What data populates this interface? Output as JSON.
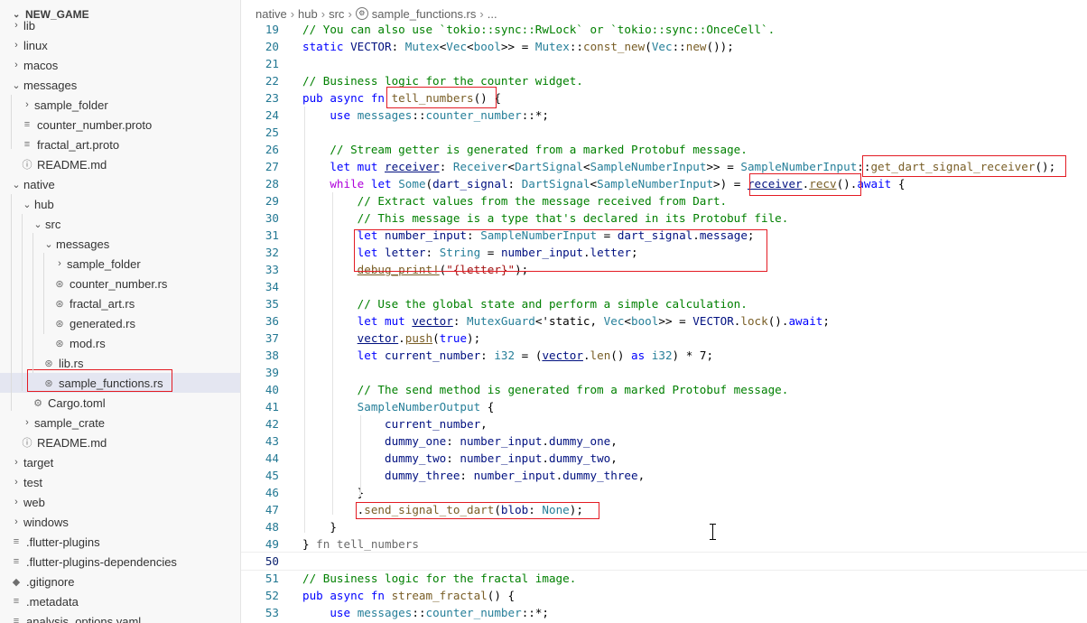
{
  "explorer": {
    "root_label": "NEW_GAME",
    "items": [
      {
        "label": "lib",
        "kind": "folder-closed",
        "depth": 1
      },
      {
        "label": "linux",
        "kind": "folder-closed",
        "depth": 1
      },
      {
        "label": "macos",
        "kind": "folder-closed",
        "depth": 1
      },
      {
        "label": "messages",
        "kind": "folder-open",
        "depth": 1
      },
      {
        "label": "sample_folder",
        "kind": "folder-closed",
        "depth": 2
      },
      {
        "label": "counter_number.proto",
        "kind": "file-lines",
        "depth": 2
      },
      {
        "label": "fractal_art.proto",
        "kind": "file-lines",
        "depth": 2
      },
      {
        "label": "README.md",
        "kind": "file-info",
        "depth": 2
      },
      {
        "label": "native",
        "kind": "folder-open",
        "depth": 1
      },
      {
        "label": "hub",
        "kind": "folder-open",
        "depth": 2
      },
      {
        "label": "src",
        "kind": "folder-open",
        "depth": 3
      },
      {
        "label": "messages",
        "kind": "folder-open",
        "depth": 4
      },
      {
        "label": "sample_folder",
        "kind": "folder-closed",
        "depth": 5
      },
      {
        "label": "counter_number.rs",
        "kind": "file-rust",
        "depth": 5
      },
      {
        "label": "fractal_art.rs",
        "kind": "file-rust",
        "depth": 5
      },
      {
        "label": "generated.rs",
        "kind": "file-rust",
        "depth": 5
      },
      {
        "label": "mod.rs",
        "kind": "file-rust",
        "depth": 5
      },
      {
        "label": "lib.rs",
        "kind": "file-rust",
        "depth": 4
      },
      {
        "label": "sample_functions.rs",
        "kind": "file-rust",
        "depth": 4,
        "selected": true
      },
      {
        "label": "Cargo.toml",
        "kind": "file-gear",
        "depth": 3
      },
      {
        "label": "sample_crate",
        "kind": "folder-closed",
        "depth": 2
      },
      {
        "label": "README.md",
        "kind": "file-info",
        "depth": 2
      },
      {
        "label": "target",
        "kind": "folder-closed",
        "depth": 1
      },
      {
        "label": "test",
        "kind": "folder-closed",
        "depth": 1
      },
      {
        "label": "web",
        "kind": "folder-closed",
        "depth": 1
      },
      {
        "label": "windows",
        "kind": "folder-closed",
        "depth": 1
      },
      {
        "label": ".flutter-plugins",
        "kind": "file-lines",
        "depth": 1
      },
      {
        "label": ".flutter-plugins-dependencies",
        "kind": "file-lines",
        "depth": 1
      },
      {
        "label": ".gitignore",
        "kind": "file-git",
        "depth": 1
      },
      {
        "label": ".metadata",
        "kind": "file-lines",
        "depth": 1
      },
      {
        "label": "analysis_options.yaml",
        "kind": "file-lines",
        "depth": 1
      }
    ]
  },
  "breadcrumb": {
    "parts": [
      "native",
      "hub",
      "src",
      "sample_functions.rs",
      "..."
    ]
  },
  "editor": {
    "current_line": 50,
    "lines": [
      {
        "n": "19",
        "tokens": [
          [
            "c",
            "// You can also use `tokio::sync::RwLock` or `tokio::sync::OnceCell`."
          ]
        ]
      },
      {
        "n": "20",
        "tokens": [
          [
            "k",
            "static"
          ],
          [
            "",
            " "
          ],
          [
            "v",
            "VECTOR"
          ],
          [
            "",
            ": "
          ],
          [
            "t",
            "Mutex"
          ],
          [
            "",
            "<"
          ],
          [
            "t",
            "Vec"
          ],
          [
            "",
            "<"
          ],
          [
            "t",
            "bool"
          ],
          [
            "",
            ">> = "
          ],
          [
            "t",
            "Mutex"
          ],
          [
            "",
            "::"
          ],
          [
            "f",
            "const_new"
          ],
          [
            "",
            "("
          ],
          [
            "t",
            "Vec"
          ],
          [
            "",
            "::"
          ],
          [
            "f",
            "new"
          ],
          [
            "",
            "());"
          ]
        ]
      },
      {
        "n": "21",
        "tokens": []
      },
      {
        "n": "22",
        "tokens": [
          [
            "c",
            "// Business logic for the counter widget."
          ]
        ]
      },
      {
        "n": "23",
        "tokens": [
          [
            "k",
            "pub async fn"
          ],
          [
            "",
            " "
          ],
          [
            "f",
            "tell_numbers"
          ],
          [
            "",
            "() {"
          ]
        ]
      },
      {
        "n": "24",
        "tokens": [
          [
            "",
            "    "
          ],
          [
            "k",
            "use"
          ],
          [
            "",
            " "
          ],
          [
            "t",
            "messages"
          ],
          [
            "",
            "::"
          ],
          [
            "t",
            "counter_number"
          ],
          [
            "",
            "::*;"
          ]
        ]
      },
      {
        "n": "25",
        "tokens": []
      },
      {
        "n": "26",
        "tokens": [
          [
            "",
            "    "
          ],
          [
            "c",
            "// Stream getter is generated from a marked Protobuf message."
          ]
        ]
      },
      {
        "n": "27",
        "tokens": [
          [
            "",
            "    "
          ],
          [
            "k",
            "let mut"
          ],
          [
            "",
            " "
          ],
          [
            "vu",
            "receiver"
          ],
          [
            "",
            ": "
          ],
          [
            "t",
            "Receiver"
          ],
          [
            "",
            "<"
          ],
          [
            "t",
            "DartSignal"
          ],
          [
            "",
            "<"
          ],
          [
            "t",
            "SampleNumberInput"
          ],
          [
            "",
            ">> = "
          ],
          [
            "t",
            "SampleNumberInput"
          ],
          [
            "",
            "::"
          ],
          [
            "f",
            "get_dart_signal_receiver"
          ],
          [
            "",
            "();"
          ]
        ]
      },
      {
        "n": "28",
        "tokens": [
          [
            "",
            "    "
          ],
          [
            "m",
            "while"
          ],
          [
            "",
            " "
          ],
          [
            "k",
            "let"
          ],
          [
            "",
            " "
          ],
          [
            "t",
            "Some"
          ],
          [
            "",
            "("
          ],
          [
            "v",
            "dart_signal"
          ],
          [
            "",
            ": "
          ],
          [
            "t",
            "DartSignal"
          ],
          [
            "",
            "<"
          ],
          [
            "t",
            "SampleNumberInput"
          ],
          [
            "",
            ">) = "
          ],
          [
            "vu",
            "receiver"
          ],
          [
            "",
            "."
          ],
          [
            "fu",
            "recv"
          ],
          [
            "",
            "()."
          ],
          [
            "k",
            "await"
          ],
          [
            "",
            " {"
          ]
        ]
      },
      {
        "n": "29",
        "tokens": [
          [
            "",
            "        "
          ],
          [
            "c",
            "// Extract values from the message received from Dart."
          ]
        ]
      },
      {
        "n": "30",
        "tokens": [
          [
            "",
            "        "
          ],
          [
            "c",
            "// This message is a type that's declared in its Protobuf file."
          ]
        ]
      },
      {
        "n": "31",
        "tokens": [
          [
            "",
            "        "
          ],
          [
            "k",
            "let"
          ],
          [
            "",
            " "
          ],
          [
            "v",
            "number_input"
          ],
          [
            "",
            ": "
          ],
          [
            "t",
            "SampleNumberInput"
          ],
          [
            "",
            " = "
          ],
          [
            "v",
            "dart_signal"
          ],
          [
            "",
            "."
          ],
          [
            "v",
            "message"
          ],
          [
            "",
            ";"
          ]
        ]
      },
      {
        "n": "32",
        "tokens": [
          [
            "",
            "        "
          ],
          [
            "k",
            "let"
          ],
          [
            "",
            " "
          ],
          [
            "v",
            "letter"
          ],
          [
            "",
            ": "
          ],
          [
            "t",
            "String"
          ],
          [
            "",
            " = "
          ],
          [
            "v",
            "number_input"
          ],
          [
            "",
            "."
          ],
          [
            "v",
            "letter"
          ],
          [
            "",
            ";"
          ]
        ]
      },
      {
        "n": "33",
        "tokens": [
          [
            "",
            "        "
          ],
          [
            "fu",
            "debug_print!"
          ],
          [
            "",
            "("
          ],
          [
            "s",
            "\"{letter}\""
          ],
          [
            "",
            ");"
          ]
        ]
      },
      {
        "n": "34",
        "tokens": []
      },
      {
        "n": "35",
        "tokens": [
          [
            "",
            "        "
          ],
          [
            "c",
            "// Use the global state and perform a simple calculation."
          ]
        ]
      },
      {
        "n": "36",
        "tokens": [
          [
            "",
            "        "
          ],
          [
            "k",
            "let mut"
          ],
          [
            "",
            " "
          ],
          [
            "vu",
            "vector"
          ],
          [
            "",
            ": "
          ],
          [
            "t",
            "MutexGuard"
          ],
          [
            "",
            "<'static, "
          ],
          [
            "t",
            "Vec"
          ],
          [
            "",
            "<"
          ],
          [
            "t",
            "bool"
          ],
          [
            "",
            ">> = "
          ],
          [
            "v",
            "VECTOR"
          ],
          [
            "",
            "."
          ],
          [
            "f",
            "lock"
          ],
          [
            "",
            "()."
          ],
          [
            "k",
            "await"
          ],
          [
            "",
            ";"
          ]
        ]
      },
      {
        "n": "37",
        "tokens": [
          [
            "",
            "        "
          ],
          [
            "vu",
            "vector"
          ],
          [
            "",
            "."
          ],
          [
            "fu",
            "push"
          ],
          [
            "",
            "("
          ],
          [
            "k",
            "true"
          ],
          [
            "",
            ");"
          ]
        ]
      },
      {
        "n": "38",
        "tokens": [
          [
            "",
            "        "
          ],
          [
            "k",
            "let"
          ],
          [
            "",
            " "
          ],
          [
            "v",
            "current_number"
          ],
          [
            "",
            ": "
          ],
          [
            "t",
            "i32"
          ],
          [
            "",
            " = ("
          ],
          [
            "vu",
            "vector"
          ],
          [
            "",
            "."
          ],
          [
            "f",
            "len"
          ],
          [
            "",
            "() "
          ],
          [
            "k",
            "as"
          ],
          [
            "",
            " "
          ],
          [
            "t",
            "i32"
          ],
          [
            "",
            ") * 7;"
          ]
        ]
      },
      {
        "n": "39",
        "tokens": []
      },
      {
        "n": "40",
        "tokens": [
          [
            "",
            "        "
          ],
          [
            "c",
            "// The send method is generated from a marked Protobuf message."
          ]
        ]
      },
      {
        "n": "41",
        "tokens": [
          [
            "",
            "        "
          ],
          [
            "t",
            "SampleNumberOutput"
          ],
          [
            "",
            " {"
          ]
        ]
      },
      {
        "n": "42",
        "tokens": [
          [
            "",
            "            "
          ],
          [
            "v",
            "current_number"
          ],
          [
            "",
            ","
          ]
        ]
      },
      {
        "n": "43",
        "tokens": [
          [
            "",
            "            "
          ],
          [
            "v",
            "dummy_one"
          ],
          [
            "",
            ": "
          ],
          [
            "v",
            "number_input"
          ],
          [
            "",
            "."
          ],
          [
            "v",
            "dummy_one"
          ],
          [
            "",
            ","
          ]
        ]
      },
      {
        "n": "44",
        "tokens": [
          [
            "",
            "            "
          ],
          [
            "v",
            "dummy_two"
          ],
          [
            "",
            ": "
          ],
          [
            "v",
            "number_input"
          ],
          [
            "",
            "."
          ],
          [
            "v",
            "dummy_two"
          ],
          [
            "",
            ","
          ]
        ]
      },
      {
        "n": "45",
        "tokens": [
          [
            "",
            "            "
          ],
          [
            "v",
            "dummy_three"
          ],
          [
            "",
            ": "
          ],
          [
            "v",
            "number_input"
          ],
          [
            "",
            "."
          ],
          [
            "v",
            "dummy_three"
          ],
          [
            "",
            ","
          ]
        ]
      },
      {
        "n": "46",
        "tokens": [
          [
            "",
            "        }"
          ]
        ]
      },
      {
        "n": "47",
        "tokens": [
          [
            "",
            "        ."
          ],
          [
            "f",
            "send_signal_to_dart"
          ],
          [
            "",
            "("
          ],
          [
            "v",
            "blob"
          ],
          [
            "",
            ": "
          ],
          [
            "t",
            "None"
          ],
          [
            "",
            ");"
          ]
        ]
      },
      {
        "n": "48",
        "tokens": [
          [
            "",
            "    }"
          ]
        ]
      },
      {
        "n": "49",
        "tokens": [
          [
            "",
            "} "
          ],
          [
            "x",
            "fn tell_numbers"
          ]
        ]
      },
      {
        "n": "50",
        "tokens": []
      },
      {
        "n": "51",
        "tokens": [
          [
            "c",
            "// Business logic for the fractal image."
          ]
        ]
      },
      {
        "n": "52",
        "tokens": [
          [
            "k",
            "pub async fn"
          ],
          [
            "",
            " "
          ],
          [
            "f",
            "stream_fractal"
          ],
          [
            "",
            "() {"
          ]
        ]
      },
      {
        "n": "53",
        "tokens": [
          [
            "",
            "    "
          ],
          [
            "k",
            "use"
          ],
          [
            "",
            " "
          ],
          [
            "t",
            "messages"
          ],
          [
            "",
            "::"
          ],
          [
            "t",
            "counter_number"
          ],
          [
            "",
            "::*;"
          ]
        ]
      }
    ]
  },
  "colors": {
    "keyword": "#0000ff",
    "comment": "#008000",
    "type": "#267f99",
    "function": "#795e26",
    "variable": "#001080",
    "string": "#a31515",
    "control": "#af00db",
    "highlight_box": "#e31b23",
    "line_number": "#237893",
    "selection_bg": "#e4e6f1"
  }
}
